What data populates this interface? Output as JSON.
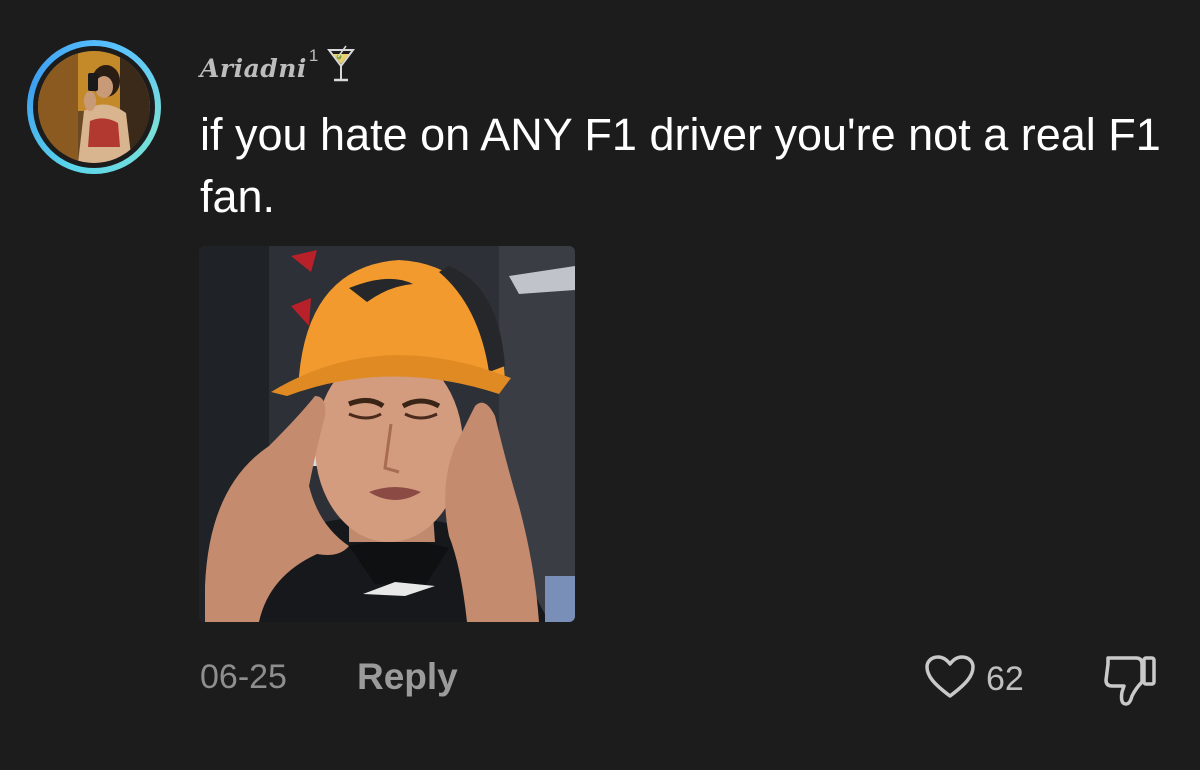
{
  "comment": {
    "username": "Ariadni",
    "username_superscript": "1",
    "username_badge_icon": "martini-glass-icon",
    "text": "if you hate on ANY F1 driver you're not a real F1 fan.",
    "date": "06-25",
    "reply_label": "Reply",
    "like_count": "62",
    "like_icon": "heart-outline-icon",
    "dislike_icon": "thumbs-down-icon"
  },
  "colors": {
    "background": "#1c1c1d",
    "text_primary": "#ffffff",
    "text_secondary": "#8e8e8e",
    "avatar_ring": "#4fb3f0"
  }
}
